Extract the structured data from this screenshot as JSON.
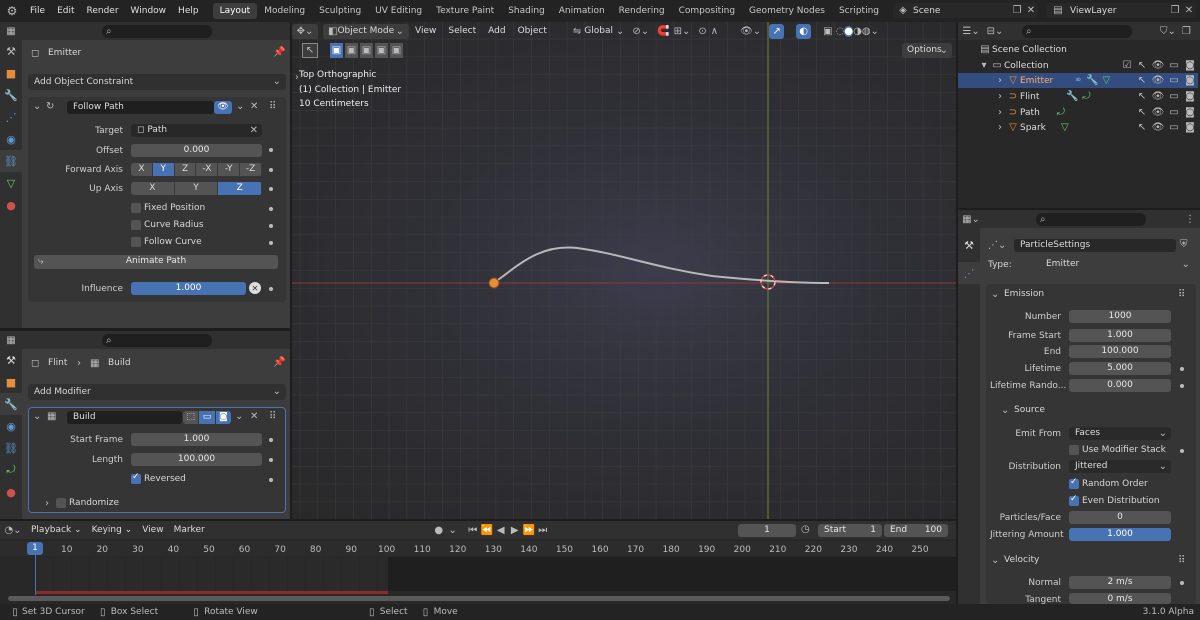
{
  "menu": [
    "File",
    "Edit",
    "Render",
    "Window",
    "Help"
  ],
  "workspaces": [
    "Layout",
    "Modeling",
    "Sculpting",
    "UV Editing",
    "Texture Paint",
    "Shading",
    "Animation",
    "Rendering",
    "Compositing",
    "Geometry Nodes",
    "Scripting"
  ],
  "active_workspace": "Layout",
  "add_workspace": "+",
  "scene": "Scene",
  "view_layer": "ViewLayer",
  "constraint_panel": {
    "object_name": "Emitter",
    "add_label": "Add Object Constraint",
    "name": "Follow Path",
    "target_label": "Target",
    "target_value": "Path",
    "offset_label": "Offset",
    "offset_value": "0.000",
    "forward_label": "Forward Axis",
    "forward_axes": [
      "X",
      "Y",
      "Z",
      "-X",
      "-Y",
      "-Z"
    ],
    "forward_active": "Y",
    "up_label": "Up Axis",
    "up_axes": [
      "X",
      "Y",
      "Z"
    ],
    "up_active": "Z",
    "fixed_position": "Fixed Position",
    "curve_radius": "Curve Radius",
    "follow_curve": "Follow Curve",
    "animate_path": "Animate Path",
    "influence_label": "Influence",
    "influence_value": "1.000"
  },
  "modifier_panel": {
    "object_name": "Flint",
    "modifier_breadcrumb": "Build",
    "add_label": "Add Modifier",
    "name": "Build",
    "start_frame_label": "Start Frame",
    "start_frame_value": "1.000",
    "length_label": "Length",
    "length_value": "100.000",
    "reversed": "Reversed",
    "randomize": "Randomize"
  },
  "viewport": {
    "mode": "Object Mode",
    "menus": [
      "View",
      "Select",
      "Add",
      "Object"
    ],
    "orientation": "Global",
    "options": "Options",
    "info": [
      "Top Orthographic",
      "(1) Collection | Emitter",
      "10 Centimeters"
    ]
  },
  "outliner": {
    "scene_collection": "Scene Collection",
    "collection": "Collection",
    "objects": [
      "Emitter",
      "Flint",
      "Path",
      "Spark"
    ]
  },
  "particle_panel": {
    "settings_name": "ParticleSettings",
    "type_label": "Type:",
    "type_value": "Emitter",
    "emission_title": "Emission",
    "number_label": "Number",
    "number_value": "1000",
    "frame_start_label": "Frame Start",
    "frame_start_value": "1.000",
    "end_label": "End",
    "end_value": "100.000",
    "lifetime_label": "Lifetime",
    "lifetime_value": "5.000",
    "lifetime_random_label": "Lifetime Rando...",
    "lifetime_random_value": "0.000",
    "source_title": "Source",
    "emit_from_label": "Emit From",
    "emit_from_value": "Faces",
    "use_modifier_stack": "Use Modifier Stack",
    "distribution_label": "Distribution",
    "distribution_value": "Jittered",
    "random_order": "Random Order",
    "even_distribution": "Even Distribution",
    "particles_face_label": "Particles/Face",
    "particles_face_value": "0",
    "jittering_label": "Jittering Amount",
    "jittering_value": "1.000",
    "velocity_title": "Velocity",
    "normal_label": "Normal",
    "normal_value": "2 m/s",
    "tangent_label": "Tangent",
    "tangent_value": "0 m/s"
  },
  "timeline": {
    "menus": [
      "Playback",
      "Keying",
      "View",
      "Marker"
    ],
    "current_frame": "1",
    "start_label": "Start",
    "start_value": "1",
    "end_label": "End",
    "end_value": "100",
    "ticks": [
      "1",
      "10",
      "20",
      "30",
      "40",
      "50",
      "60",
      "70",
      "80",
      "90",
      "100",
      "110",
      "120",
      "130",
      "140",
      "150",
      "160",
      "170",
      "180",
      "190",
      "200",
      "210",
      "220",
      "230",
      "240",
      "250"
    ]
  },
  "status": {
    "set_cursor": "Set 3D Cursor",
    "box_select": "Box Select",
    "rotate_view": "Rotate View",
    "select": "Select",
    "move": "Move",
    "version": "3.1.0 Alpha"
  },
  "colors": {
    "accent": "#4772b3",
    "panel": "#303030",
    "field": "#545454",
    "viewport": "#3a3a44",
    "selected_row": "#334d80"
  }
}
